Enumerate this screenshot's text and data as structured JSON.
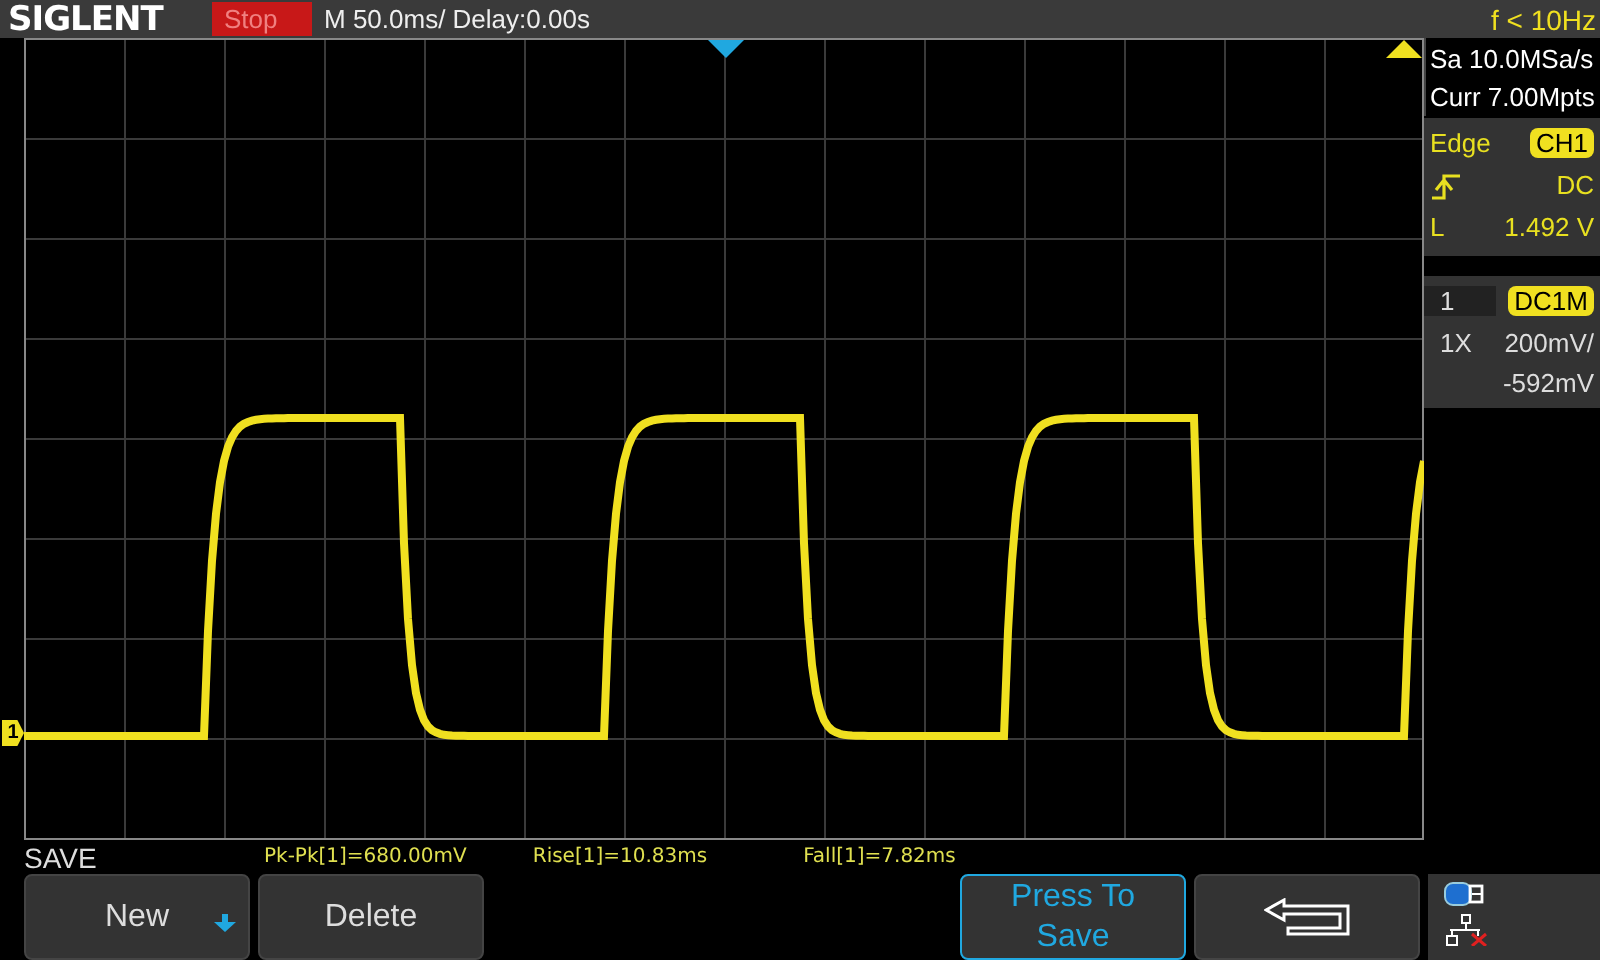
{
  "brand": "SIGLENT",
  "run_state": "Stop",
  "timebase": "M 50.0ms/ Delay:0.00s",
  "frequency": "f < 10Hz",
  "acquisition": {
    "sample_rate": "Sa 10.0MSa/s",
    "memory": "Curr 7.00Mpts"
  },
  "trigger": {
    "type": "Edge",
    "source": "CH1",
    "coupling": "DC",
    "level_label": "L",
    "level_value": "1.492 V"
  },
  "channel": {
    "number": "1",
    "coupling": "DC1M",
    "probe": "1X",
    "scale": "200mV/",
    "offset": "-592mV"
  },
  "channel_marker": "1",
  "measurements": [
    "Pk-Pk[1]=680.00mV",
    "Rise[1]=10.83ms",
    "Fall[1]=7.82ms"
  ],
  "menu": {
    "title": "SAVE",
    "buttons": [
      {
        "kind": "dropdown",
        "label": "New"
      },
      {
        "kind": "plain",
        "label": "Delete"
      },
      {
        "kind": "highlight",
        "label": "Press To Save"
      },
      {
        "kind": "back"
      }
    ]
  }
}
